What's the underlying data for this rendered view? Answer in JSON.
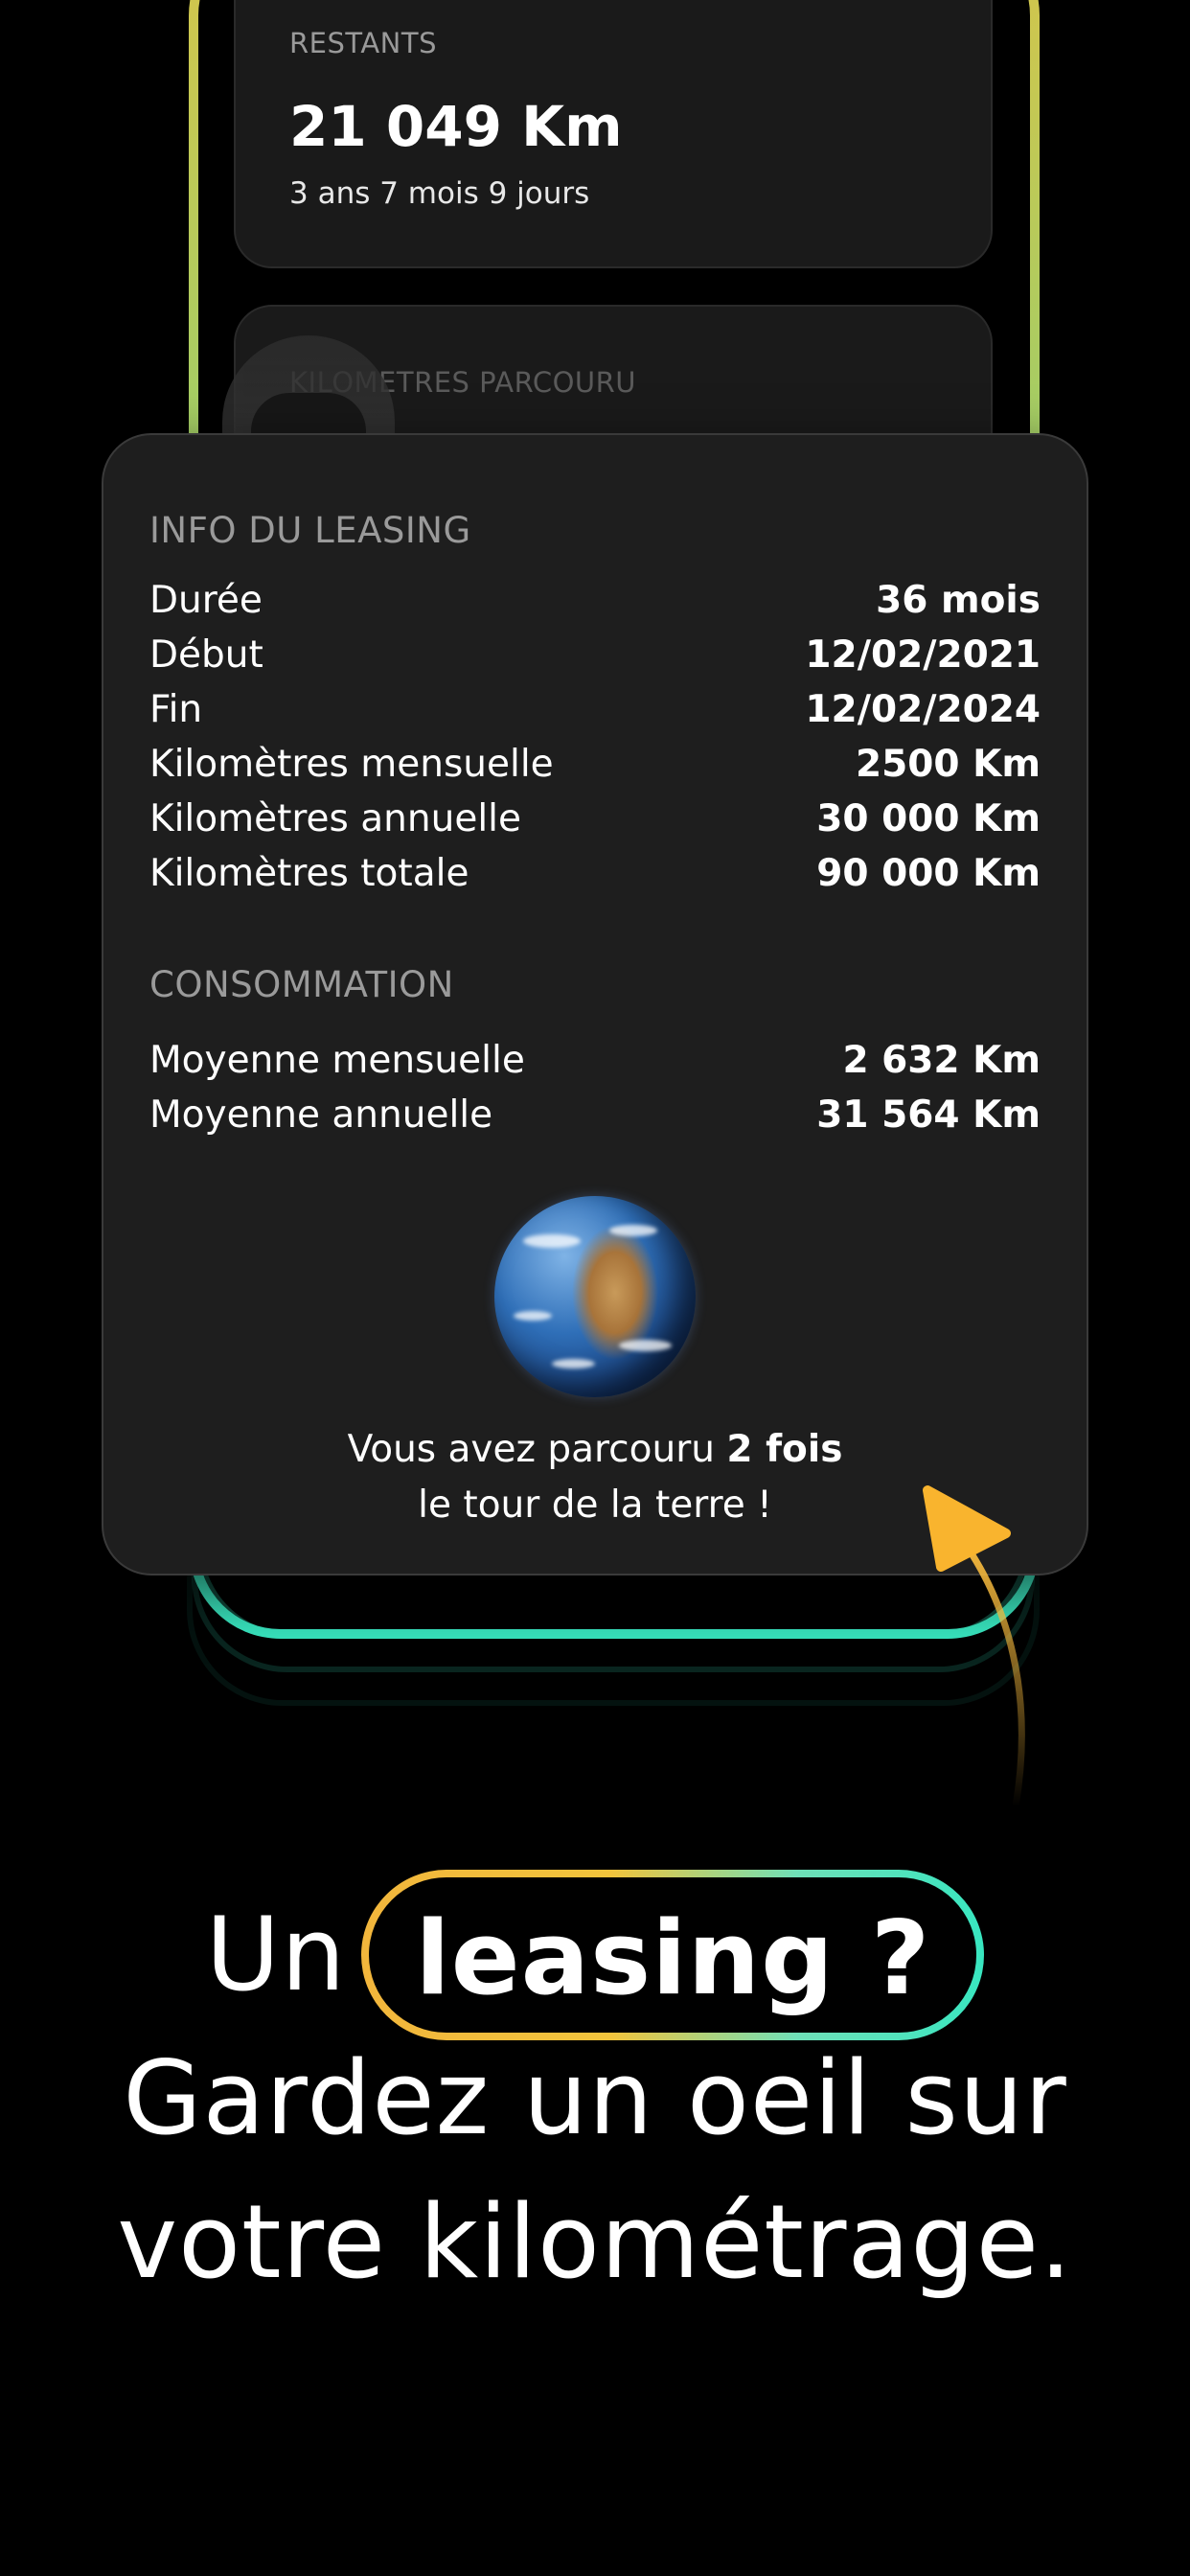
{
  "remaining_card": {
    "label": "RESTANTS",
    "value": "21 049 Km",
    "duration": "3 ans 7 mois 9 jours"
  },
  "traveled_card": {
    "label": "KILOMETRES PARCOURU"
  },
  "leasing_info": {
    "title": "INFO DU LEASING",
    "rows": [
      {
        "label": "Durée",
        "value": "36 mois"
      },
      {
        "label": "Début",
        "value": "12/02/2021"
      },
      {
        "label": "Fin",
        "value": "12/02/2024"
      },
      {
        "label": "Kilomètres mensuelle",
        "value": "2500 Km"
      },
      {
        "label": "Kilomètres annuelle",
        "value": "30 000 Km"
      },
      {
        "label": "Kilomètres totale",
        "value": "90 000 Km"
      }
    ]
  },
  "consumption": {
    "title": "CONSOMMATION",
    "rows": [
      {
        "label": "Moyenne mensuelle",
        "value": "2 632 Km"
      },
      {
        "label": "Moyenne annuelle",
        "value": "31 564 Km"
      }
    ]
  },
  "earth_message": {
    "prefix": "Vous avez parcouru",
    "highlight": "2 fois",
    "suffix": "le tour de la terre !",
    "icon": "earth-globe-icon"
  },
  "headline": {
    "line1_prefix": "Un",
    "line1_highlight": "leasing ?",
    "line2": "Gardez un oeil sur",
    "line3": "votre kilométrage."
  },
  "colors": {
    "background": "#000000",
    "card": "#1e1e1e",
    "accent_yellow": "#f2b63c",
    "accent_teal": "#38e6c0"
  }
}
